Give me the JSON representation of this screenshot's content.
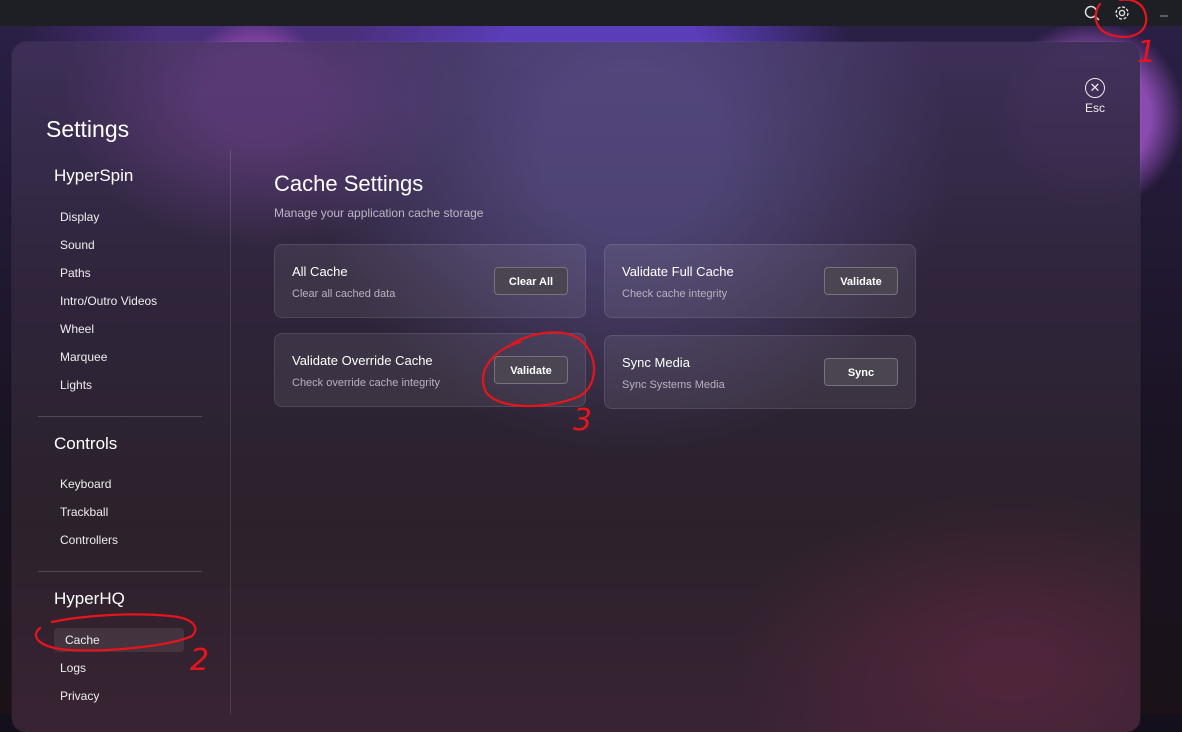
{
  "titlebar": {
    "icons": [
      "search-icon",
      "gear-icon",
      "minimize-icon"
    ]
  },
  "esc": {
    "label": "Esc",
    "icon": "close-circle-icon"
  },
  "sidebar": {
    "title": "Settings",
    "sections": [
      {
        "title": "HyperSpin",
        "items": [
          "Display",
          "Sound",
          "Paths",
          "Intro/Outro Videos",
          "Wheel",
          "Marquee",
          "Lights"
        ]
      },
      {
        "title": "Controls",
        "items": [
          "Keyboard",
          "Trackball",
          "Controllers"
        ]
      },
      {
        "title": "HyperHQ",
        "items": [
          "Cache",
          "Logs",
          "Privacy"
        ]
      }
    ],
    "active_item": "Cache"
  },
  "main": {
    "title": "Cache Settings",
    "subtitle": "Manage your application cache storage",
    "cards": [
      {
        "title": "All Cache",
        "description": "Clear all cached data",
        "button": "Clear All"
      },
      {
        "title": "Validate Full Cache",
        "description": "Check cache integrity",
        "button": "Validate"
      },
      {
        "title": "Validate Override Cache",
        "description": "Check override cache integrity",
        "button": "Validate"
      },
      {
        "title": "Sync Media",
        "description": "Sync Systems Media",
        "button": "Sync"
      }
    ]
  },
  "annotations": {
    "marks": [
      "1",
      "2",
      "3"
    ],
    "color": "#e8141c"
  }
}
